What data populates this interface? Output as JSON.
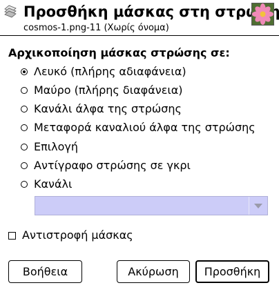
{
  "header": {
    "title": "Προσθήκη μάσκας στη στρώση",
    "subtitle": "cosmos-1.png-11 (Χωρίς όνομα)",
    "icon": "layer-mask-icon",
    "thumbnail": "flower-thumbnail"
  },
  "init": {
    "label": "Αρχικοποίηση μάσκας στρώσης σε:",
    "options": [
      {
        "label": "Λευκό (πλήρης αδιαφάνεια)",
        "checked": true
      },
      {
        "label": "Μαύρο (πλήρης διαφάνεια)",
        "checked": false
      },
      {
        "label": "Κανάλι άλφα της στρώσης",
        "checked": false
      },
      {
        "label": "Μεταφορά καναλιού άλφα της στρώσης",
        "checked": false
      },
      {
        "label": "Επιλογή",
        "checked": false
      },
      {
        "label": "Αντίγραφο στρώσης σε γκρι",
        "checked": false
      },
      {
        "label": "Κανάλι",
        "checked": false
      }
    ],
    "channel_value": ""
  },
  "invert": {
    "label": "Αντιστροφή μάσκας",
    "checked": false
  },
  "buttons": {
    "help": "Βοήθεια",
    "cancel": "Ακύρωση",
    "add": "Προσθήκη"
  },
  "colors": {
    "combo_bg": "#ccccf8"
  }
}
